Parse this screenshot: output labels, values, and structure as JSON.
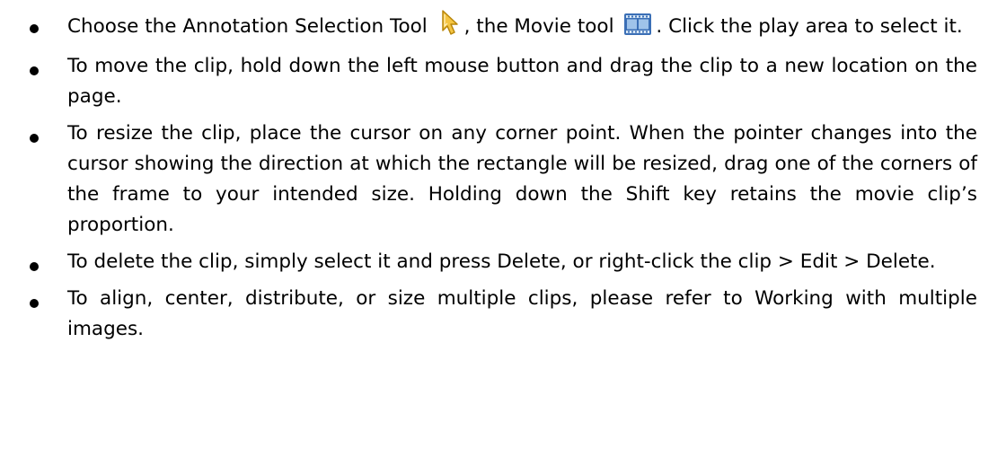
{
  "bullets": [
    {
      "part1": "Choose the Annotation Selection Tool",
      "icon1": "annotation-selection-tool-icon",
      "part2": ", the Movie tool",
      "icon2": "movie-tool-icon",
      "part3": ". Click the play area to select it."
    },
    {
      "text": "To move the clip, hold down the left mouse button and drag the clip to a new location on the page."
    },
    {
      "text": "To resize the clip, place the cursor on any corner point. When the pointer changes into the cursor showing the direction at which the rectangle will be resized, drag one of the corners of the frame to your intended size. Holding down the Shift key retains the movie clip’s proportion."
    },
    {
      "text": "To delete the clip, simply select it and press Delete, or right-click the clip > Edit > Delete."
    },
    {
      "text": "To align, center, distribute, or size multiple clips, please refer to Working with multiple images."
    }
  ],
  "colors": {
    "selection_icon_fill": "#f5c542",
    "selection_icon_outline": "#b8860b",
    "movie_icon_frame": "#3b6fb6",
    "movie_icon_screen": "#9fc3ea"
  }
}
